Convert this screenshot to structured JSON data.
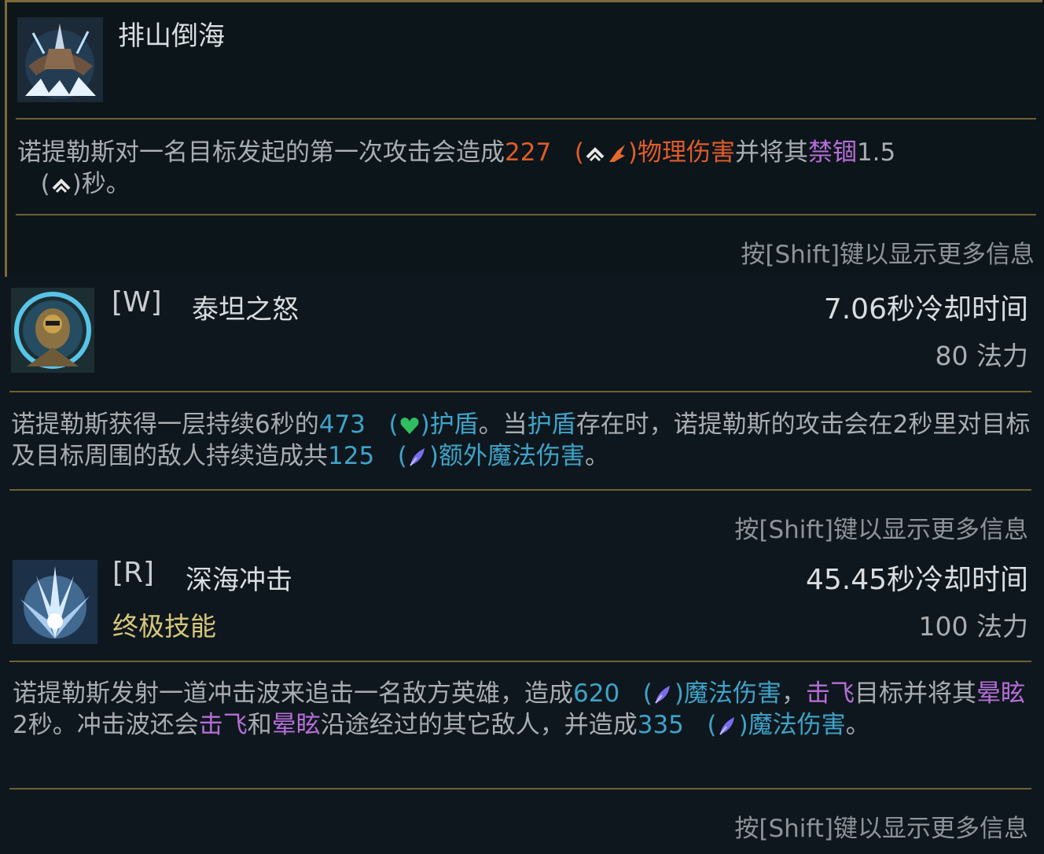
{
  "passive": {
    "name": "排山倒海",
    "desc": {
      "t1": "诺提勒斯对一名目标发起的第一次攻击会造成",
      "dmg": "227",
      "open": "(",
      "close": ")",
      "dmgtype": "物理伤害",
      "t2": "并将其",
      "root": "禁锢",
      "dur": "1.5",
      "open2": "(",
      "close2": ")",
      "t3": "秒。"
    },
    "hint": "按[Shift]键以显示更多信息"
  },
  "w": {
    "key": "[W]",
    "name": "泰坦之怒",
    "cooldown": "7.06秒冷却时间",
    "cost": "80 法力",
    "desc": {
      "t1": "诺提勒斯获得一层持续6秒的",
      "shield": "473",
      "open": "(",
      "close": ")",
      "shieldlbl": "护盾",
      "t2": "。当",
      "shield2": "护盾",
      "t3": "存在时，诺提勒斯的攻击会在2秒里对目标及目标周围的敌人持续造成共",
      "dmg": "125",
      "open2": "(",
      "close2": ")",
      "dmgtype": "额外魔法伤害",
      "t4": "。"
    },
    "hint": "按[Shift]键以显示更多信息"
  },
  "r": {
    "key": "[R]",
    "name": "深海冲击",
    "tag": "终极技能",
    "cooldown": "45.45秒冷却时间",
    "cost": "100 法力",
    "desc": {
      "t1": "诺提勒斯发射一道冲击波来追击一名敌方英雄，造成",
      "dmg": "620",
      "open": "(",
      "close": ")",
      "dmgtype": "魔法伤害",
      "comma": "，",
      "knock": "击飞",
      "t2": "目标并将其",
      "stun": "晕眩",
      "t3": "2秒。冲击波还会",
      "knock2": "击飞",
      "and": "和",
      "stun2": "晕眩",
      "t4": "沿途经过的其它敌人，并造成",
      "dmg2": "335",
      "open2": "(",
      "close2": ")",
      "dmgtype2": "魔法伤害",
      "t5": "。"
    },
    "hint": "按[Shift]键以显示更多信息"
  },
  "colors": {
    "gold_rule": "#6f6034",
    "physical": "#e05c2b",
    "crowd_control": "#b66ed7",
    "magic": "#3fa3c9",
    "shield": "#3fa3c9",
    "ultimate": "#d8c77a"
  },
  "icons": [
    "anchor-ability-icon",
    "titans-wrath-icon",
    "depth-charge-icon",
    "attack-damage-scaling-icon",
    "armor-scaling-icon",
    "health-scaling-icon",
    "ability-power-scaling-icon"
  ]
}
